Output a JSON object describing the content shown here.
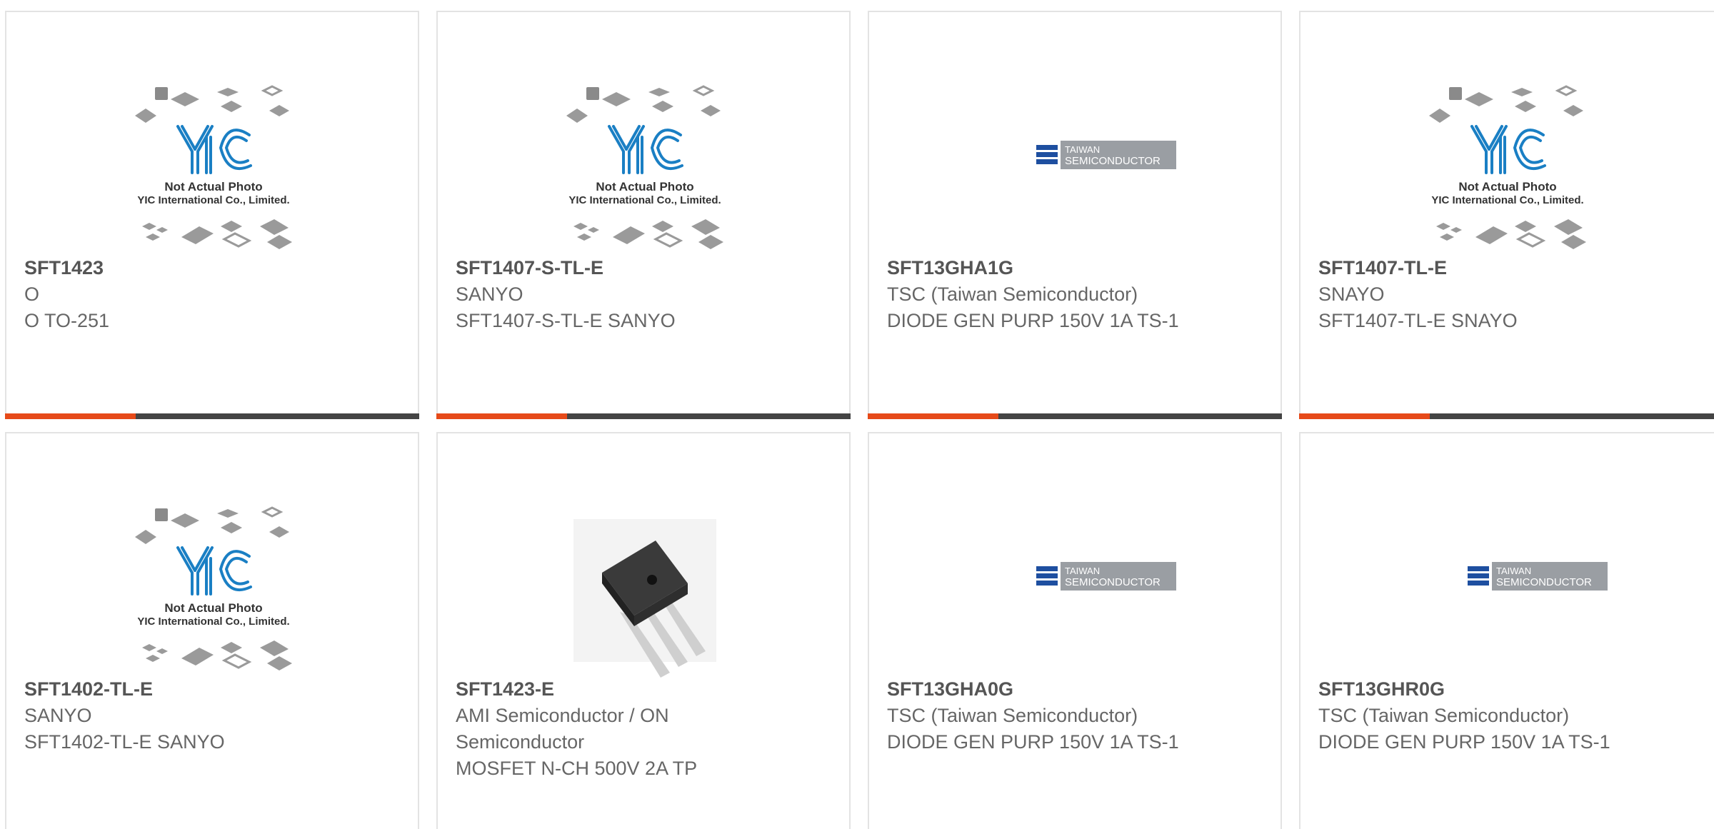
{
  "placeholder": {
    "line1": "Not Actual Photo",
    "line2": "YIC International Co., Limited.",
    "brand": "YIC"
  },
  "tsc_logo": {
    "line1": "TAIWAN",
    "line2": "SEMICONDUCTOR"
  },
  "colors": {
    "accent": "#e64a19",
    "bar": "#444444",
    "text": "#666666",
    "yic_blue": "#1a7fc4"
  },
  "products": [
    {
      "part": "SFT1423",
      "maker": "O",
      "desc": "O TO-251",
      "image": "yic-placeholder"
    },
    {
      "part": "SFT1407-S-TL-E",
      "maker": "SANYO",
      "desc": "SFT1407-S-TL-E SANYO",
      "image": "yic-placeholder"
    },
    {
      "part": "SFT13GHA1G",
      "maker": "TSC (Taiwan Semiconductor)",
      "desc": "DIODE GEN PURP 150V 1A TS-1",
      "image": "tsc-logo"
    },
    {
      "part": "SFT1407-TL-E",
      "maker": "SNAYO",
      "desc": "SFT1407-TL-E SNAYO",
      "image": "yic-placeholder"
    },
    {
      "part": "SFT1402-TL-E",
      "maker": "SANYO",
      "desc": "SFT1402-TL-E SANYO",
      "image": "yic-placeholder"
    },
    {
      "part": "SFT1423-E",
      "maker": "AMI Semiconductor / ON Semiconductor",
      "desc": "MOSFET N-CH 500V 2A TP",
      "image": "to-251-photo"
    },
    {
      "part": "SFT13GHA0G",
      "maker": "TSC (Taiwan Semiconductor)",
      "desc": "DIODE GEN PURP 150V 1A TS-1",
      "image": "tsc-logo"
    },
    {
      "part": "SFT13GHR0G",
      "maker": "TSC (Taiwan Semiconductor)",
      "desc": "DIODE GEN PURP 150V 1A TS-1",
      "image": "tsc-logo"
    }
  ]
}
